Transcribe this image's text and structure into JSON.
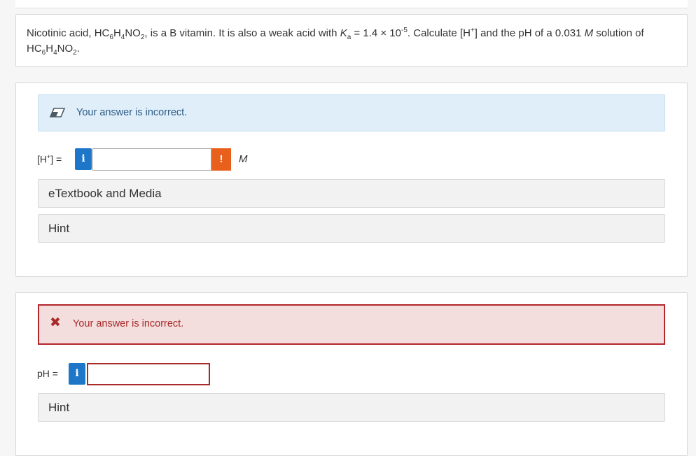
{
  "question": {
    "parts": [
      {
        "t": "Nicotinic acid, HC"
      },
      {
        "sub": "6"
      },
      {
        "t": "H"
      },
      {
        "sub": "4"
      },
      {
        "t": "NO"
      },
      {
        "sub": "2"
      },
      {
        "t": ", is a B vitamin. It is also a weak acid with "
      },
      {
        "i": "K"
      },
      {
        "sub": "a"
      },
      {
        "t": " = 1.4 × 10"
      },
      {
        "sup": "-5"
      },
      {
        "t": ". Calculate [H"
      },
      {
        "sup": "+"
      },
      {
        "t": "] and the pH of a 0.031 "
      },
      {
        "i": "M"
      },
      {
        "t": " solution of HC"
      },
      {
        "sub": "6"
      },
      {
        "t": "H"
      },
      {
        "sub": "4"
      },
      {
        "t": "NO"
      },
      {
        "sub": "2"
      },
      {
        "t": "."
      }
    ]
  },
  "part1": {
    "banner_text": "Your answer is incorrect.",
    "label_prefix": "[H",
    "label_sup": "+",
    "label_suffix": "] =",
    "info_glyph": "i",
    "input_value": "",
    "alert_glyph": "!",
    "unit": "M",
    "expanders": [
      "eTextbook and Media",
      "Hint"
    ]
  },
  "part2": {
    "banner_icon": "✖",
    "banner_text": "Your answer is incorrect.",
    "label": "pH =",
    "info_glyph": "i",
    "input_value": "",
    "expanders": [
      "Hint"
    ]
  },
  "icons": {
    "info_banner": "pencil-eraser-icon",
    "error_banner": "x-mark-icon",
    "info_button": "info-icon",
    "alert": "exclamation-icon"
  },
  "colors": {
    "info_blue": "#1d76c7",
    "banner_blue_bg": "#dfeef9",
    "error_red": "#a82a2a",
    "error_bg": "#f4dddd",
    "alert_orange": "#e8601c"
  }
}
